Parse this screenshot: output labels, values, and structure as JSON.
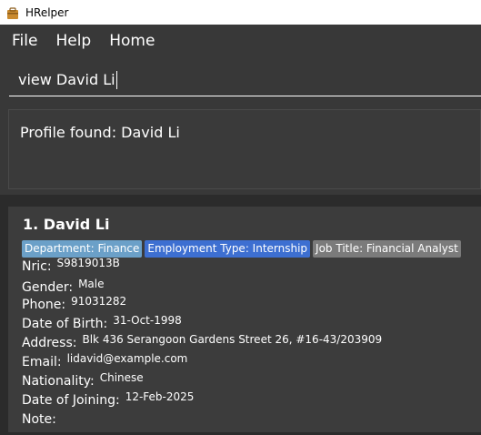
{
  "window": {
    "title": "HRelper"
  },
  "menu": {
    "items": [
      "File",
      "Help",
      "Home"
    ]
  },
  "command": {
    "value": "view David Li"
  },
  "result": {
    "text": "Profile found: David Li"
  },
  "person": {
    "header": "1.  David Li",
    "tags": {
      "department": "Department: Finance",
      "employment_type": "Employment Type: Internship",
      "job_title": "Job Title: Financial Analyst"
    },
    "fields": [
      {
        "label": "Nric:",
        "value": "S9819013B"
      },
      {
        "label": "Gender:",
        "value": "Male"
      },
      {
        "label": "Phone:",
        "value": "91031282"
      },
      {
        "label": "Date of Birth:",
        "value": "31-Oct-1998"
      },
      {
        "label": "Address:",
        "value": "Blk 436 Serangoon Gardens Street 26, #16-43/203909"
      },
      {
        "label": "Email:",
        "value": "lidavid@example.com"
      },
      {
        "label": "Nationality:",
        "value": "Chinese"
      },
      {
        "label": "Date of Joining:",
        "value": "12-Feb-2025"
      },
      {
        "label": "Note:",
        "value": ""
      }
    ]
  },
  "colors": {
    "tag_department": "#6ba0c8",
    "tag_employment": "#3d6fd1",
    "tag_job": "#7b7b7b",
    "background": "#2b2b2b",
    "panel": "#383838"
  }
}
